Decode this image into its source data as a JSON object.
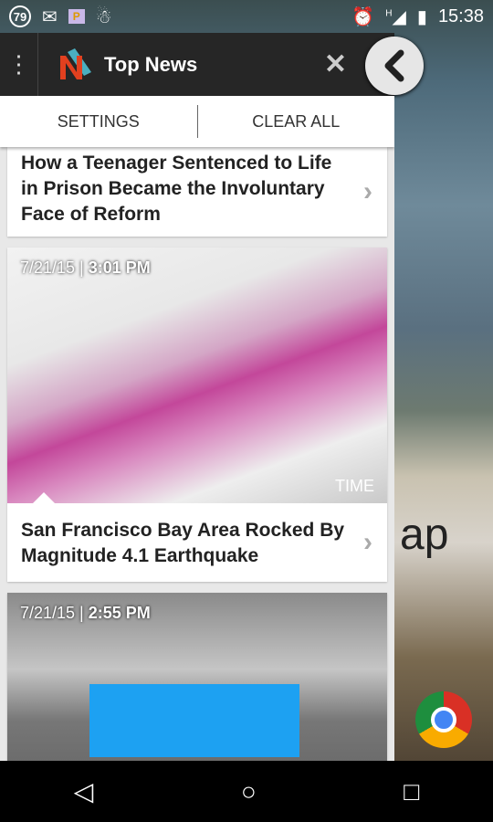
{
  "status_bar": {
    "notification_count": "79",
    "time": "15:38",
    "network": "H",
    "icons": [
      "gmail-icon",
      "p-app-icon",
      "android-icon",
      "alarm-icon",
      "signal-icon",
      "battery-charging-icon"
    ]
  },
  "toolbar": {
    "title": "Top News",
    "menu_icon": "more-vert-icon",
    "close_icon": "close-icon",
    "back_icon": "chevron-left-icon"
  },
  "actions": {
    "settings": "SETTINGS",
    "clear_all": "CLEAR ALL"
  },
  "articles": [
    {
      "headline": "How a Teenager Sentenced to Life in Prison Became the Involuntary Face of Reform"
    },
    {
      "date": "7/21/15 |",
      "time": "3:01 PM",
      "source": "TIME",
      "headline": "San Francisco Bay Area Rocked By Magnitude 4.1 Earthquake"
    },
    {
      "date": "7/21/15 |",
      "time": "2:55 PM"
    }
  ],
  "background": {
    "text": "ap"
  },
  "nav": {
    "back": "◁",
    "home": "○",
    "recents": "□"
  }
}
